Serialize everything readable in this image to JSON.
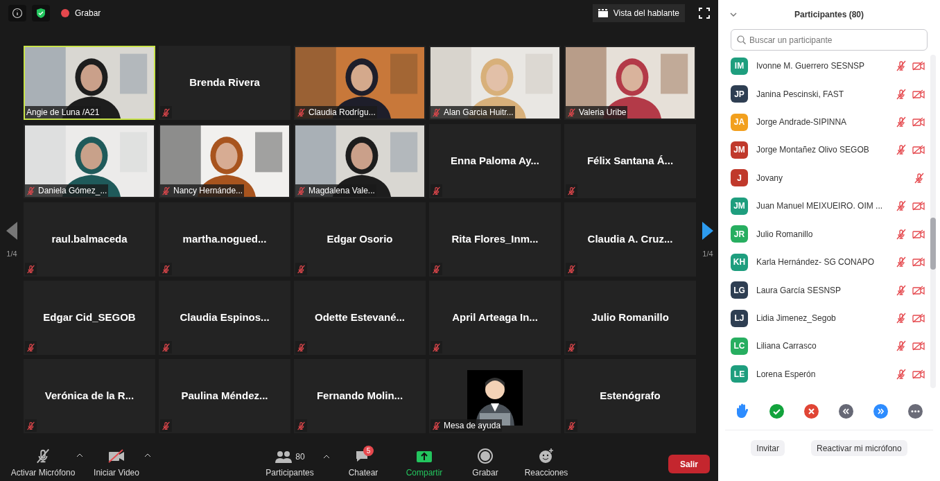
{
  "top_bar": {
    "record_label": "Grabar",
    "view_button": "Vista del hablante"
  },
  "tiles": [
    {
      "kind": "video",
      "name": "Angie de Luna /A21",
      "muted": false,
      "speaking": true
    },
    {
      "kind": "name",
      "name": "Brenda Rivera",
      "muted": true,
      "speaking": false
    },
    {
      "kind": "video",
      "name": "Claudia Rodrígu...",
      "muted": true,
      "speaking": false
    },
    {
      "kind": "video",
      "name": "Alan Garcia Huitr...",
      "muted": true,
      "speaking": false
    },
    {
      "kind": "video",
      "name": "Valeria Uribe",
      "muted": true,
      "speaking": false
    },
    {
      "kind": "video",
      "name": "Daniela Gómez_...",
      "muted": true,
      "speaking": false
    },
    {
      "kind": "video",
      "name": "Nancy Hernánde...",
      "muted": true,
      "speaking": false
    },
    {
      "kind": "video",
      "name": "Magdalena Vale...",
      "muted": true,
      "speaking": false
    },
    {
      "kind": "name",
      "name": "Enna Paloma Ay...",
      "muted": true,
      "speaking": false
    },
    {
      "kind": "name",
      "name": "Félix Santana Á...",
      "muted": true,
      "speaking": false
    },
    {
      "kind": "name",
      "name": "raul.balmaceda",
      "muted": true,
      "speaking": false
    },
    {
      "kind": "name",
      "name": "martha.nogued...",
      "muted": true,
      "speaking": false
    },
    {
      "kind": "name",
      "name": "Edgar Osorio",
      "muted": true,
      "speaking": false
    },
    {
      "kind": "name",
      "name": "Rita Flores_Inm...",
      "muted": true,
      "speaking": false
    },
    {
      "kind": "name",
      "name": "Claudia A. Cruz...",
      "muted": true,
      "speaking": false
    },
    {
      "kind": "name",
      "name": "Edgar Cid_SEGOB",
      "muted": true,
      "speaking": false
    },
    {
      "kind": "name",
      "name": "Claudia Espinos...",
      "muted": true,
      "speaking": false
    },
    {
      "kind": "name",
      "name": "Odette Estevané...",
      "muted": true,
      "speaking": false
    },
    {
      "kind": "name",
      "name": "April Arteaga In...",
      "muted": true,
      "speaking": false
    },
    {
      "kind": "name",
      "name": "Julio Romanillo",
      "muted": true,
      "speaking": false
    },
    {
      "kind": "name",
      "name": "Verónica de la R...",
      "muted": true,
      "speaking": false
    },
    {
      "kind": "name",
      "name": "Paulina Méndez...",
      "muted": true,
      "speaking": false
    },
    {
      "kind": "name",
      "name": "Fernando Molin...",
      "muted": true,
      "speaking": false
    },
    {
      "kind": "avatar",
      "name": "Mesa de ayuda",
      "muted": true,
      "speaking": false
    },
    {
      "kind": "name",
      "name": "Estenógrafo",
      "muted": true,
      "speaking": false
    }
  ],
  "pager": {
    "left_label": "1/4",
    "right_label": "1/4"
  },
  "toolbar": {
    "mic_label": "Activar Micrófono",
    "video_label": "Iniciar Video",
    "participants_label": "Participantes",
    "participants_count": "80",
    "chat_label": "Chatear",
    "chat_badge": "5",
    "share_label": "Compartir",
    "record_label": "Grabar",
    "reactions_label": "Reacciones",
    "leave_button": "Salir"
  },
  "panel": {
    "title": "Participantes (80)",
    "search": {
      "placeholder": "Buscar un participante"
    },
    "participants": [
      {
        "initials": "IM",
        "name": "Ivonne M. Guerrero SESNSP",
        "color": "#1e9e7e",
        "muted": true,
        "video_off": true
      },
      {
        "initials": "JP",
        "name": "Janina Pescinski, FAST",
        "color": "#2e3e52",
        "muted": true,
        "video_off": true
      },
      {
        "initials": "JA",
        "name": "Jorge Andrade-SIPINNA",
        "color": "#f2a01e",
        "muted": true,
        "video_off": true
      },
      {
        "initials": "JM",
        "name": "Jorge Montañez Olivo SEGOB",
        "color": "#c0392b",
        "muted": true,
        "video_off": true
      },
      {
        "initials": "J",
        "name": "Jovany",
        "color": "#c0392b",
        "muted": true,
        "video_off": false
      },
      {
        "initials": "JM",
        "name": "Juan Manuel MEIXUEIRO. OIM ...",
        "color": "#1e9e7e",
        "muted": true,
        "video_off": true
      },
      {
        "initials": "JR",
        "name": "Julio Romanillo",
        "color": "#27ae60",
        "muted": true,
        "video_off": true
      },
      {
        "initials": "KH",
        "name": "Karla Hernández- SG CONAPO",
        "color": "#1e9e7e",
        "muted": true,
        "video_off": true
      },
      {
        "initials": "LG",
        "name": "Laura García SESNSP",
        "color": "#2e3e52",
        "muted": true,
        "video_off": true
      },
      {
        "initials": "LJ",
        "name": "Lidia Jimenez_Segob",
        "color": "#2e3e52",
        "muted": true,
        "video_off": true
      },
      {
        "initials": "LC",
        "name": "Liliana Carrasco",
        "color": "#27ae60",
        "muted": true,
        "video_off": true
      },
      {
        "initials": "LE",
        "name": "Lorena Esperón",
        "color": "#1e9e7e",
        "muted": true,
        "video_off": true
      }
    ],
    "footer_buttons": [
      "Invitar",
      "Reactivar mi micrófono"
    ]
  }
}
